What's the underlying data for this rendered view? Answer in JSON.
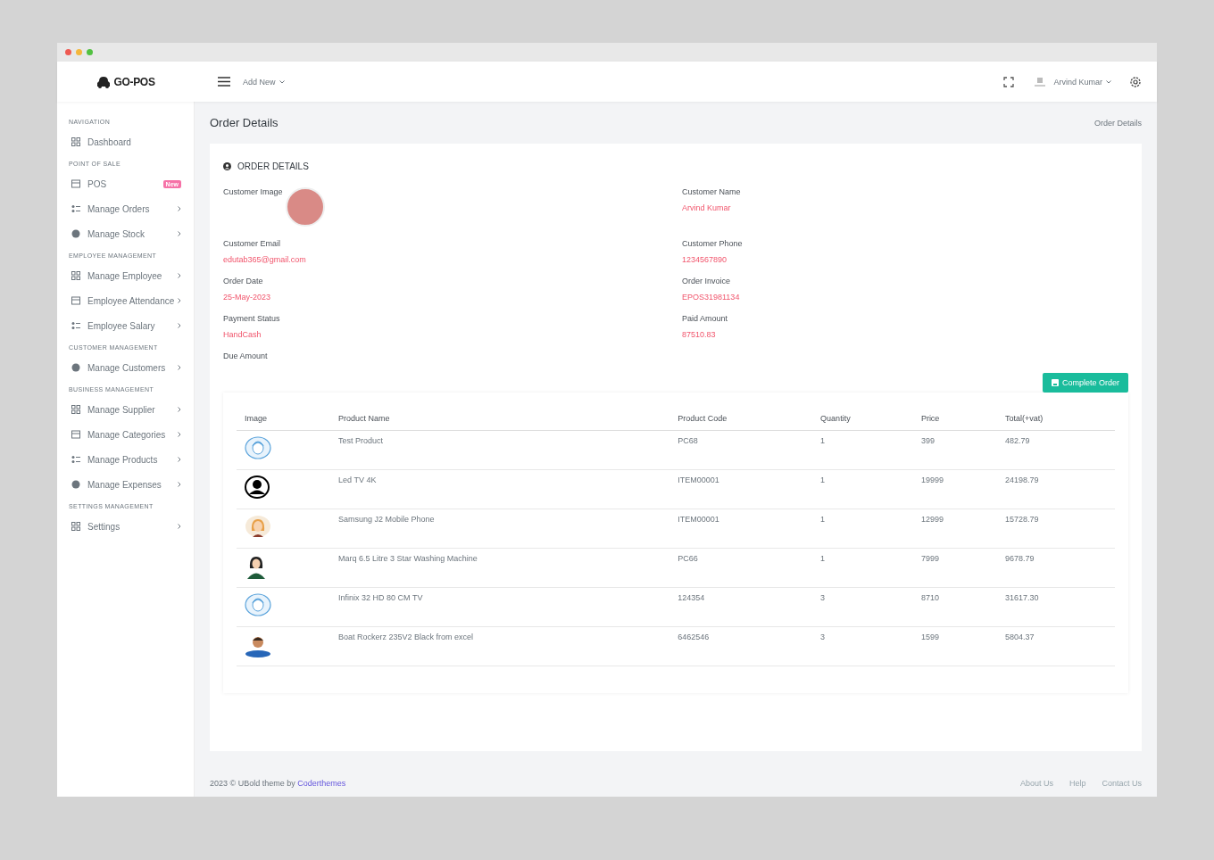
{
  "topbar": {
    "logo": "GO-POS",
    "add_new": "Add New",
    "user": "Arvind Kumar"
  },
  "sidebar": {
    "sections": [
      {
        "heading": "NAVIGATION",
        "items": [
          {
            "label": "Dashboard",
            "submenu": false
          }
        ]
      },
      {
        "heading": "POINT OF SALE",
        "items": [
          {
            "label": "POS",
            "submenu": false,
            "badge": "New"
          },
          {
            "label": "Manage Orders",
            "submenu": true
          },
          {
            "label": "Manage Stock",
            "submenu": true
          }
        ]
      },
      {
        "heading": "EMPLOYEE MANAGEMENT",
        "items": [
          {
            "label": "Manage Employee",
            "submenu": true
          },
          {
            "label": "Employee Attendance",
            "submenu": true
          },
          {
            "label": "Employee Salary",
            "submenu": true
          }
        ]
      },
      {
        "heading": "CUSTOMER MANAGEMENT",
        "items": [
          {
            "label": "Manage Customers",
            "submenu": true
          }
        ]
      },
      {
        "heading": "BUSINESS MANAGEMENT",
        "items": [
          {
            "label": "Manage Supplier",
            "submenu": true
          },
          {
            "label": "Manage Categories",
            "submenu": true
          },
          {
            "label": "Manage Products",
            "submenu": true
          },
          {
            "label": "Manage Expenses",
            "submenu": true
          }
        ]
      },
      {
        "heading": "SETTINGS MANAGEMENT",
        "items": [
          {
            "label": "Settings",
            "submenu": true
          }
        ]
      }
    ]
  },
  "page": {
    "title": "Order Details",
    "breadcrumb": "Order Details"
  },
  "card": {
    "title": "ORDER DETAILS",
    "details": [
      {
        "kind": "image",
        "label": "Customer Image"
      },
      {
        "kind": "text",
        "label": "Customer Name",
        "value": "Arvind Kumar"
      },
      {
        "kind": "text",
        "label": "Customer Email",
        "value": "edutab365@gmail.com"
      },
      {
        "kind": "text",
        "label": "Customer Phone",
        "value": "1234567890"
      },
      {
        "kind": "text",
        "label": "Order Date",
        "value": "25-May-2023"
      },
      {
        "kind": "text",
        "label": "Order Invoice",
        "value": "EPOS31981134"
      },
      {
        "kind": "text",
        "label": "Payment Status",
        "value": "HandCash"
      },
      {
        "kind": "text",
        "label": "Paid Amount",
        "value": "87510.83"
      },
      {
        "kind": "text",
        "label": "Due Amount"
      }
    ],
    "button": "Complete Order"
  },
  "table": {
    "columns": [
      "Image",
      "Product Name",
      "Product Code",
      "Quantity",
      "Price",
      "Total(+vat)"
    ],
    "rows": [
      {
        "kind": "outline",
        "name": "Test Product",
        "code": "PC68",
        "quantity": "1",
        "price": "399",
        "total": "482.79"
      },
      {
        "kind": "silhouette",
        "name": "Led TV 4K",
        "code": "ITEM00001",
        "quantity": "1",
        "price": "19999",
        "total": "24198.79"
      },
      {
        "kind": "female",
        "name": "Samsung J2 Mobile Phone",
        "code": "ITEM00001",
        "quantity": "1",
        "price": "12999",
        "total": "15728.79"
      },
      {
        "kind": "female-dark",
        "name": "Marq 6.5 Litre 3 Star Washing Machine",
        "code": "PC66",
        "quantity": "1",
        "price": "7999",
        "total": "9678.79"
      },
      {
        "kind": "outline",
        "name": "Infinix 32 HD 80 CM TV",
        "code": "124354",
        "quantity": "3",
        "price": "8710",
        "total": "31617.30"
      },
      {
        "kind": "male",
        "name": "Boat Rockerz 235V2 Black from excel",
        "code": "6462546",
        "quantity": "3",
        "price": "1599",
        "total": "5804.37"
      }
    ]
  },
  "footer": {
    "text": "2023 © UBold theme by",
    "link": "Coderthemes",
    "links": [
      "About Us",
      "Help",
      "Contact Us"
    ]
  }
}
